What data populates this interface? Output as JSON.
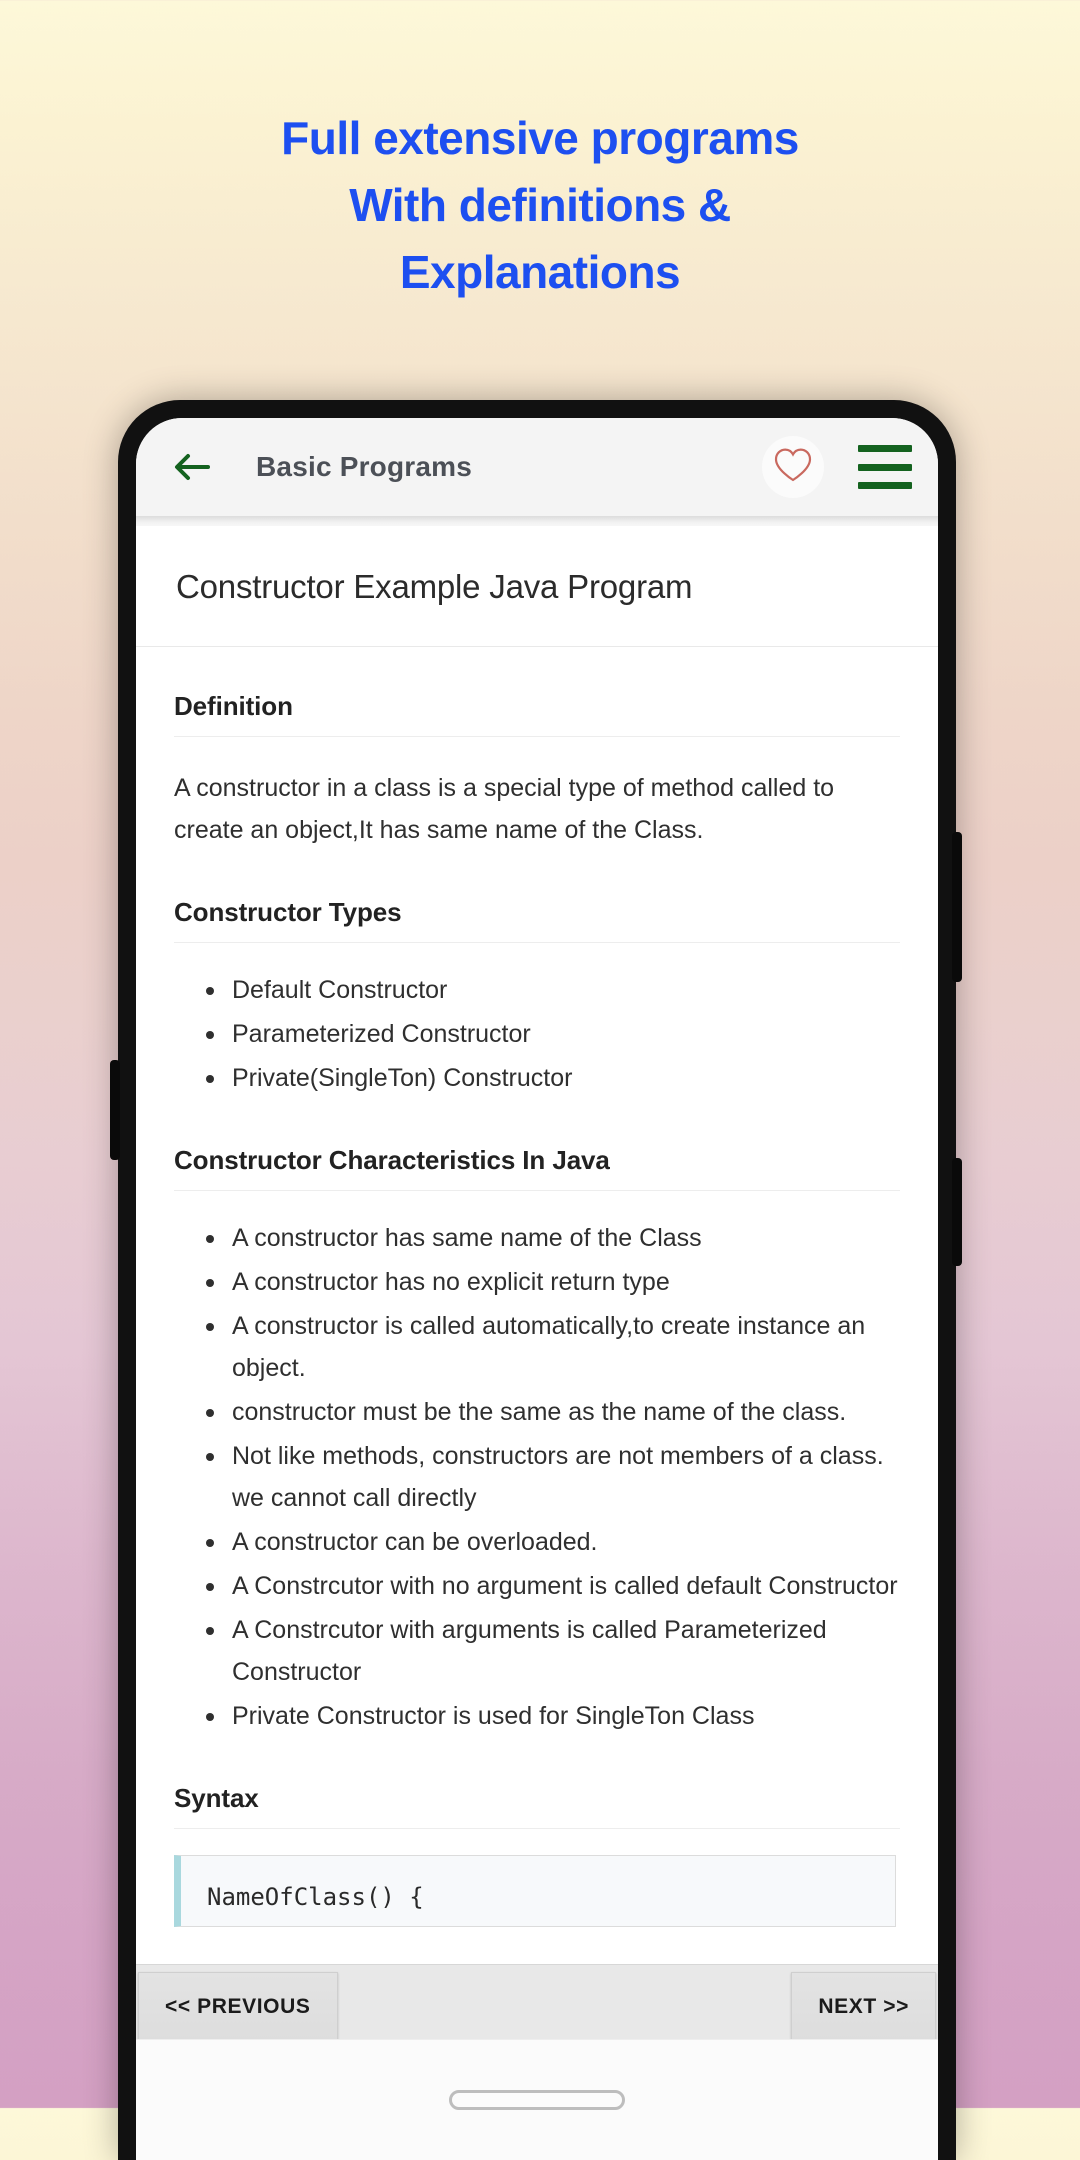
{
  "promo": {
    "lines": [
      "Full extensive programs",
      "With definitions &",
      "Explanations"
    ],
    "color": "#1d4ff0"
  },
  "app": {
    "appbar": {
      "back_icon": "back-arrow-icon",
      "title": "Basic Programs",
      "favorite_icon": "heart-outline-icon",
      "favorite_color": "#c9695f",
      "menu_icon": "hamburger-menu-icon",
      "menu_color": "#14621f"
    },
    "article": {
      "title": "Constructor Example Java Program",
      "sections": [
        {
          "heading": "Definition",
          "paragraph": "A constructor in a class is a special type of method called to create an object,It has same name of the Class."
        },
        {
          "heading": "Constructor Types",
          "bullets": [
            "Default Constructor",
            "Parameterized Constructor",
            "Private(SingleTon) Constructor"
          ]
        },
        {
          "heading": "Constructor Characteristics In Java",
          "bullets": [
            "A constructor has same name of the Class",
            "A constructor has no explicit return type",
            "A constructor is called automatically,to create instance an object.",
            "constructor must be the same as the name of the class.",
            "Not like methods, constructors are not members of a class. we cannot call directly",
            "A constructor can be overloaded.",
            "A Constrcutor with no argument is called default Constructor",
            "A Constrcutor with arguments is called Parameterized Constructor",
            "Private Constructor is used for SingleTon Class"
          ]
        },
        {
          "heading": "Syntax",
          "code": "NameOfClass() {"
        }
      ]
    },
    "navbar": {
      "previous_label": "<< PREVIOUS",
      "next_label": "NEXT >>"
    },
    "gesture": {
      "home_indicator": "home-indicator"
    }
  }
}
